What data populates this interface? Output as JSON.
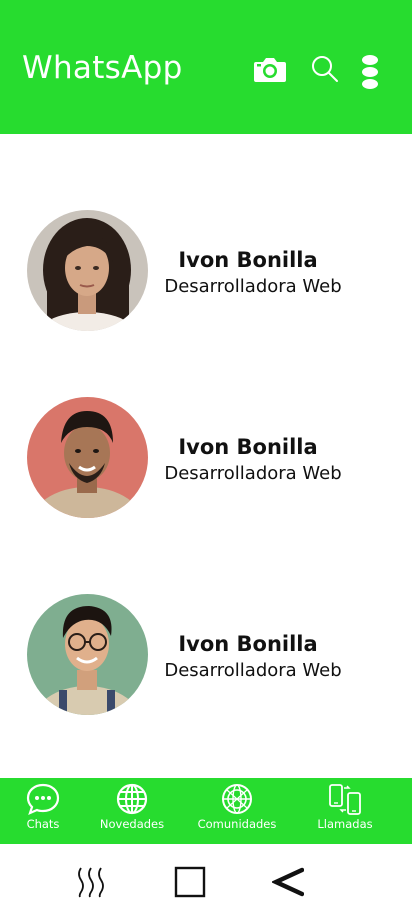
{
  "app": {
    "title": "WhatsApp",
    "accent_color": "#27dc2f"
  },
  "header": {
    "icons": [
      "camera-icon",
      "search-icon",
      "more-options-icon"
    ]
  },
  "contacts": [
    {
      "name": "Ivon Bonilla",
      "role": "Desarrolladora Web",
      "avatar": "woman-portrait"
    },
    {
      "name": "Ivon Bonilla",
      "role": "Desarrolladora Web",
      "avatar": "man-portrait"
    },
    {
      "name": "Ivon Bonilla",
      "role": "Desarrolladora Web",
      "avatar": "man-glasses-portrait"
    }
  ],
  "bottom_nav": [
    {
      "label": "Chats",
      "icon": "chat-bubble-icon"
    },
    {
      "label": "Novedades",
      "icon": "globe-icon"
    },
    {
      "label": "Comunidades",
      "icon": "community-globe-icon"
    },
    {
      "label": "Llamadas",
      "icon": "phones-icon"
    }
  ],
  "system_nav": {
    "icons": [
      "recent-apps-icon",
      "home-icon",
      "back-icon"
    ]
  }
}
